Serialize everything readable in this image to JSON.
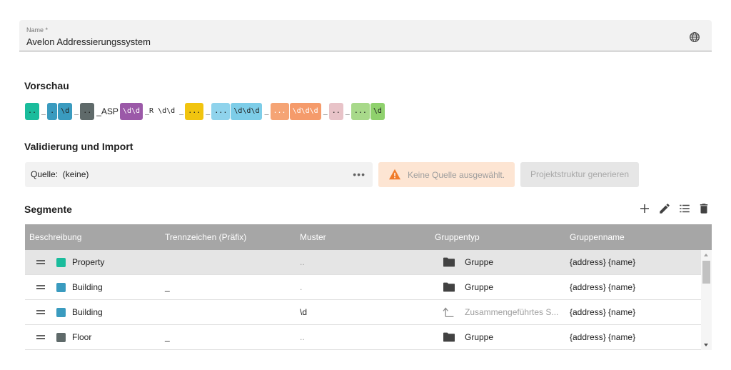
{
  "name_field": {
    "label": "Name *",
    "value": "Avelon Addressierungssystem",
    "icon": "globe-icon"
  },
  "preview": {
    "title": "Vorschau",
    "tokens": [
      {
        "kind": "chip",
        "text": "..",
        "color": "#1abc9c"
      },
      {
        "kind": "sep",
        "text": "_"
      },
      {
        "kind": "chip",
        "text": ".",
        "color": "#3a9bbf"
      },
      {
        "kind": "chip",
        "text": "\\d",
        "color": "#3a9bbf"
      },
      {
        "kind": "sep",
        "text": "_"
      },
      {
        "kind": "chip",
        "text": "..",
        "color": "#5f6a6a"
      },
      {
        "kind": "sep",
        "text": "_ASP",
        "sans": true
      },
      {
        "kind": "chip",
        "text": "\\d\\d",
        "color": "#9b59a8",
        "light": true
      },
      {
        "kind": "sep",
        "text": "_R \\d\\d _"
      },
      {
        "kind": "chip",
        "text": "...",
        "color": "#f1c40f"
      },
      {
        "kind": "sep",
        "text": "_"
      },
      {
        "kind": "chip",
        "text": "...",
        "color": "#8fd3ec"
      },
      {
        "kind": "chip",
        "text": "\\d\\d\\d",
        "color": "#7dcde8"
      },
      {
        "kind": "sep",
        "text": "_"
      },
      {
        "kind": "chip",
        "text": "...",
        "color": "#f5a475",
        "light": true
      },
      {
        "kind": "chip",
        "text": "\\d\\d\\d",
        "color": "#f59b6b",
        "light": true
      },
      {
        "kind": "sep",
        "text": "_"
      },
      {
        "kind": "chip",
        "text": "..",
        "color": "#e8c3c8"
      },
      {
        "kind": "sep",
        "text": "_"
      },
      {
        "kind": "chip",
        "text": "...",
        "color": "#a8d98a"
      },
      {
        "kind": "chip",
        "text": "\\d",
        "color": "#8fd16d"
      }
    ]
  },
  "validation": {
    "title": "Validierung und Import",
    "source_label": "Quelle:",
    "source_value": "(keine)",
    "more_icon": "more-horizontal-icon",
    "warning_text": "Keine Quelle ausgewählt.",
    "warning_icon": "warning-icon",
    "generate_label": "Projektstruktur generieren"
  },
  "segments": {
    "title": "Segmente",
    "toolbar": [
      "add-icon",
      "edit-icon",
      "list-icon",
      "delete-icon"
    ],
    "columns": [
      "Beschreibung",
      "Trennzeichen (Präfix)",
      "Muster",
      "Gruppentyp",
      "Gruppenname"
    ],
    "rows": [
      {
        "description": "Property",
        "color": "#1abc9c",
        "separator": "",
        "pattern": "..",
        "group_type": "Gruppe",
        "group_icon": "folder-icon",
        "group_name": "{address} {name}",
        "selected": true
      },
      {
        "description": "Building",
        "color": "#3a9bbf",
        "separator": "_",
        "pattern": ".",
        "group_type": "Gruppe",
        "group_icon": "folder-icon",
        "group_name": "{address} {name}",
        "selected": false
      },
      {
        "description": "Building",
        "color": "#3a9bbf",
        "separator": "",
        "pattern": "\\d",
        "group_type": "Zusammengeführtes S...",
        "group_icon": "merge-arrow-icon",
        "group_name": "{address} {name}",
        "selected": false
      },
      {
        "description": "Floor",
        "color": "#5f6a6a",
        "separator": "_",
        "pattern": "..",
        "group_type": "Gruppe",
        "group_icon": "folder-icon",
        "group_name": "{address} {name}",
        "selected": false
      }
    ]
  }
}
